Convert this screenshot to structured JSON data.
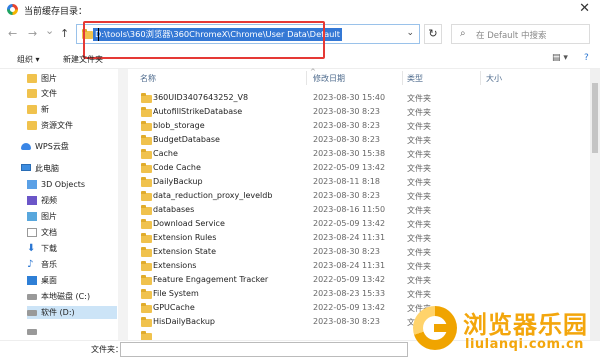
{
  "window": {
    "title": "当前缓存目录：",
    "close_glyph": "✕"
  },
  "nav": {
    "back": "←",
    "forward": "→",
    "recent": "⌄",
    "up": "↑"
  },
  "address": {
    "path": "D:\\tools\\360浏览器\\360ChromeX\\Chrome\\User Data\\Default",
    "dropdown": "⌄",
    "refresh": "↻"
  },
  "search": {
    "placeholder": "在 Default 中搜索",
    "icon": "search-icon"
  },
  "toolbar": {
    "organize": "组织 ▾",
    "new_folder": "新建文件夹",
    "view_icon": "▤ ▾",
    "help_icon": "?"
  },
  "sidebar": {
    "items": [
      {
        "label": "图片",
        "icon": "folder-icon"
      },
      {
        "label": "文件",
        "icon": "folder-icon"
      },
      {
        "label": "新",
        "icon": "folder-icon"
      },
      {
        "label": "资源文件",
        "icon": "folder-icon"
      },
      {
        "label": "WPS云盘",
        "icon": "cloud-icon"
      },
      {
        "label": "此电脑",
        "icon": "computer-icon"
      },
      {
        "label": "3D Objects",
        "icon": "3d-objects-icon"
      },
      {
        "label": "视频",
        "icon": "video-icon"
      },
      {
        "label": "图片",
        "icon": "pictures-icon"
      },
      {
        "label": "文档",
        "icon": "documents-icon"
      },
      {
        "label": "下载",
        "icon": "download-icon"
      },
      {
        "label": "音乐",
        "icon": "music-icon"
      },
      {
        "label": "桌面",
        "icon": "desktop-icon"
      },
      {
        "label": "本地磁盘 (C:)",
        "icon": "drive-icon"
      },
      {
        "label": "软件 (D:)",
        "icon": "drive-icon"
      },
      {
        "label": "",
        "icon": "drive-icon"
      }
    ]
  },
  "columns": {
    "name": "名称",
    "modified": "修改日期",
    "type": "类型",
    "size": "大小",
    "sort_indicator": "^"
  },
  "files": [
    {
      "name": "360UID3407643252_V8",
      "date": "2023-08-30 15:40",
      "type": "文件夹"
    },
    {
      "name": "AutofillStrikeDatabase",
      "date": "2023-08-30 8:23",
      "type": "文件夹"
    },
    {
      "name": "blob_storage",
      "date": "2023-08-30 8:23",
      "type": "文件夹"
    },
    {
      "name": "BudgetDatabase",
      "date": "2023-08-30 8:23",
      "type": "文件夹"
    },
    {
      "name": "Cache",
      "date": "2023-08-30 15:38",
      "type": "文件夹"
    },
    {
      "name": "Code Cache",
      "date": "2022-05-09 13:42",
      "type": "文件夹"
    },
    {
      "name": "DailyBackup",
      "date": "2023-08-11 8:18",
      "type": "文件夹"
    },
    {
      "name": "data_reduction_proxy_leveldb",
      "date": "2023-08-30 8:23",
      "type": "文件夹"
    },
    {
      "name": "databases",
      "date": "2023-08-16 11:50",
      "type": "文件夹"
    },
    {
      "name": "Download Service",
      "date": "2022-05-09 13:42",
      "type": "文件夹"
    },
    {
      "name": "Extension Rules",
      "date": "2023-08-24 11:31",
      "type": "文件夹"
    },
    {
      "name": "Extension State",
      "date": "2023-08-30 8:23",
      "type": "文件夹"
    },
    {
      "name": "Extensions",
      "date": "2023-08-24 11:31",
      "type": "文件夹"
    },
    {
      "name": "Feature Engagement Tracker",
      "date": "2022-05-09 13:42",
      "type": "文件夹"
    },
    {
      "name": "File System",
      "date": "2023-08-23 15:33",
      "type": "文件夹"
    },
    {
      "name": "GPUCache",
      "date": "2022-05-09 13:42",
      "type": "文件夹"
    },
    {
      "name": "HisDailyBackup",
      "date": "2023-08-30 8:23",
      "type": "文件夹"
    },
    {
      "name": "",
      "date": "",
      "type": ""
    }
  ],
  "footer": {
    "filename_label": "文件夹：",
    "filename_value": ""
  },
  "watermark": {
    "text": "浏览器乐园",
    "url": "liulanqi.com.cn"
  },
  "colors": {
    "selection": "#3478d5",
    "highlight_box": "#e53935",
    "sidebar_selected": "#cce4f7",
    "watermark": "#f3a60c"
  }
}
